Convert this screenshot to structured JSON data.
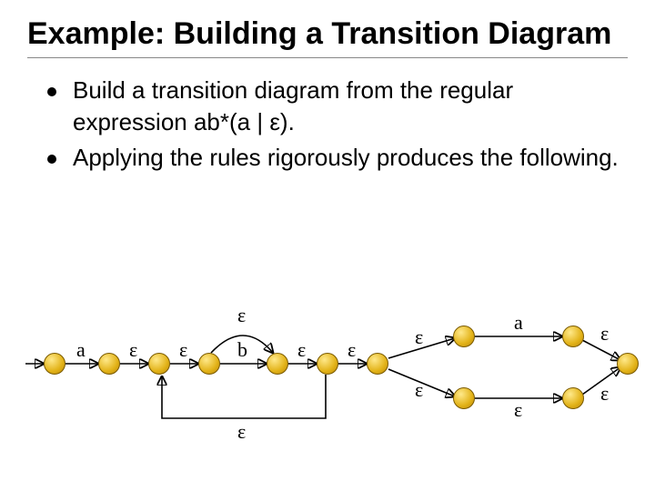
{
  "title": "Example: Building a Transition Diagram",
  "bullets": [
    "Build a transition diagram from the regular expression ab*(a | ε).",
    "Applying the rules rigorously produces the following."
  ],
  "diagram": {
    "sym_a": "a",
    "sym_b": "b",
    "sym_eps": "ε",
    "mainY": 90,
    "nodes": {
      "n1": 60,
      "n2": 120,
      "n3": 175,
      "n4": 230,
      "n5": 305,
      "n6": 360,
      "n7": 415,
      "top8": 510,
      "top9": 630,
      "bot8": 510,
      "bot9": 630,
      "n10": 690
    },
    "branchTopY": 60,
    "branchBotY": 128
  }
}
